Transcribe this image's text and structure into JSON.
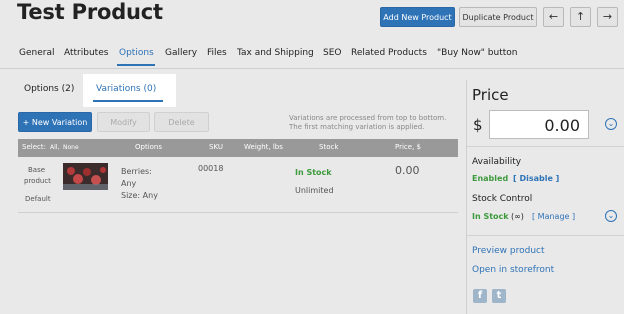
{
  "header": {
    "title": "Test Product"
  },
  "toolbar": {
    "add_new": "Add New Product",
    "duplicate": "Duplicate Product",
    "back_icon": "←",
    "up_icon": "↑",
    "forward_icon": "→"
  },
  "tabs": [
    "General",
    "Attributes",
    "Options",
    "Gallery",
    "Files",
    "Tax and Shipping",
    "SEO",
    "Related Products",
    "\"Buy Now\" button"
  ],
  "subtabs": {
    "options": "Options (2)",
    "variations": "Variations (0)"
  },
  "actions": {
    "new_variation": "+ New Variation",
    "modify": "Modify",
    "delete": "Delete"
  },
  "hint": "Variations are processed from top to bottom. The first matching variation is applied.",
  "table": {
    "select_label": "Select:",
    "select_all": "All,",
    "select_none": "None",
    "headers": {
      "options": "Options",
      "sku": "SKU",
      "weight": "Weight, lbs",
      "stock": "Stock",
      "price": "Price, $"
    },
    "row": {
      "product_line1": "Base",
      "product_line2": "product",
      "product_line3": "Default",
      "option1": "Berries:",
      "option1_val": "Any",
      "option2": "Size: Any",
      "sku": "00018",
      "stock_status": "In Stock",
      "stock_qty": "Unlimited",
      "price": "0.00"
    }
  },
  "side": {
    "price_title": "Price",
    "currency": "$",
    "price_value": "0.00",
    "availability_label": "Availability",
    "availability_status": "Enabled",
    "availability_action": "[ Disable ]",
    "stock_label": "Stock Control",
    "stock_status": "In Stock",
    "stock_infinity": "(∞)",
    "stock_action": "[ Manage ]",
    "preview": "Preview product",
    "storefront": "Open in storefront",
    "facebook": "f",
    "twitter": "t"
  }
}
